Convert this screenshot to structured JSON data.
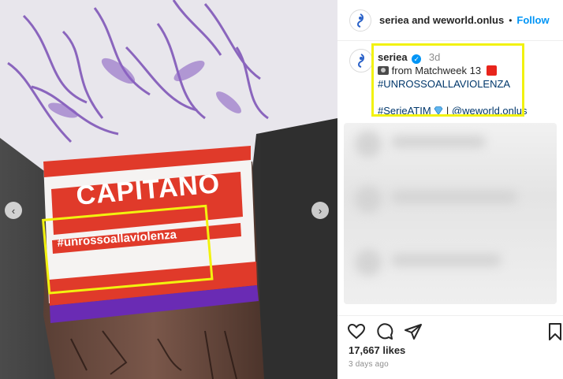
{
  "media": {
    "armband_title": "CAPITANO",
    "armband_hashtag": "#unrossoallaviolenza",
    "highlight_color": "#f2f20f"
  },
  "header": {
    "accounts": "seriea and weworld.onlus",
    "separator": "•",
    "follow_label": "Follow"
  },
  "caption": {
    "username": "seriea",
    "time": "3d",
    "line1": "from Matchweek 13",
    "hashtag1": "#UNROSSOALLAVIOLENZA",
    "hashtag2": "#SerieATIM",
    "separator": "|",
    "mention": "@weworld.onlus"
  },
  "footer": {
    "likes": "17,667 likes",
    "ago": "3 days ago"
  },
  "colors": {
    "accent": "#0095f6",
    "hashtag": "#00376b",
    "muted": "#8e8e8e"
  },
  "icons": [
    "heart-icon",
    "comment-icon",
    "share-icon",
    "bookmark-icon",
    "chevron-left-icon",
    "chevron-right-icon",
    "verified-icon"
  ]
}
